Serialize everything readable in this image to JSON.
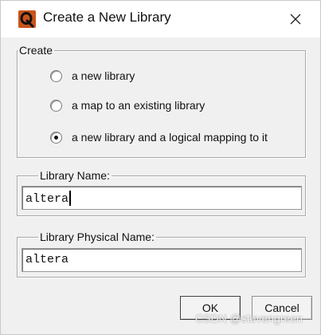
{
  "window": {
    "title": "Create a New Library"
  },
  "create_group": {
    "legend": "Create",
    "options": [
      {
        "label": "a new library",
        "selected": false
      },
      {
        "label": "a map to an existing library",
        "selected": false
      },
      {
        "label": "a new library and a logical mapping to it",
        "selected": true
      }
    ]
  },
  "library_name": {
    "legend": "Library Name:",
    "value": "altera"
  },
  "library_physical_name": {
    "legend": "Library Physical Name:",
    "value": "altera"
  },
  "buttons": {
    "ok_label": "OK",
    "cancel_label": "Cancel"
  },
  "watermark": "CSDN @stevengreen",
  "colors": {
    "app_icon_fill": "#c8541c",
    "titlebar_bg": "#ffffff",
    "dialog_bg": "#f0f0f0"
  },
  "icons": {
    "app": "questa-q-icon",
    "close": "close-icon"
  }
}
